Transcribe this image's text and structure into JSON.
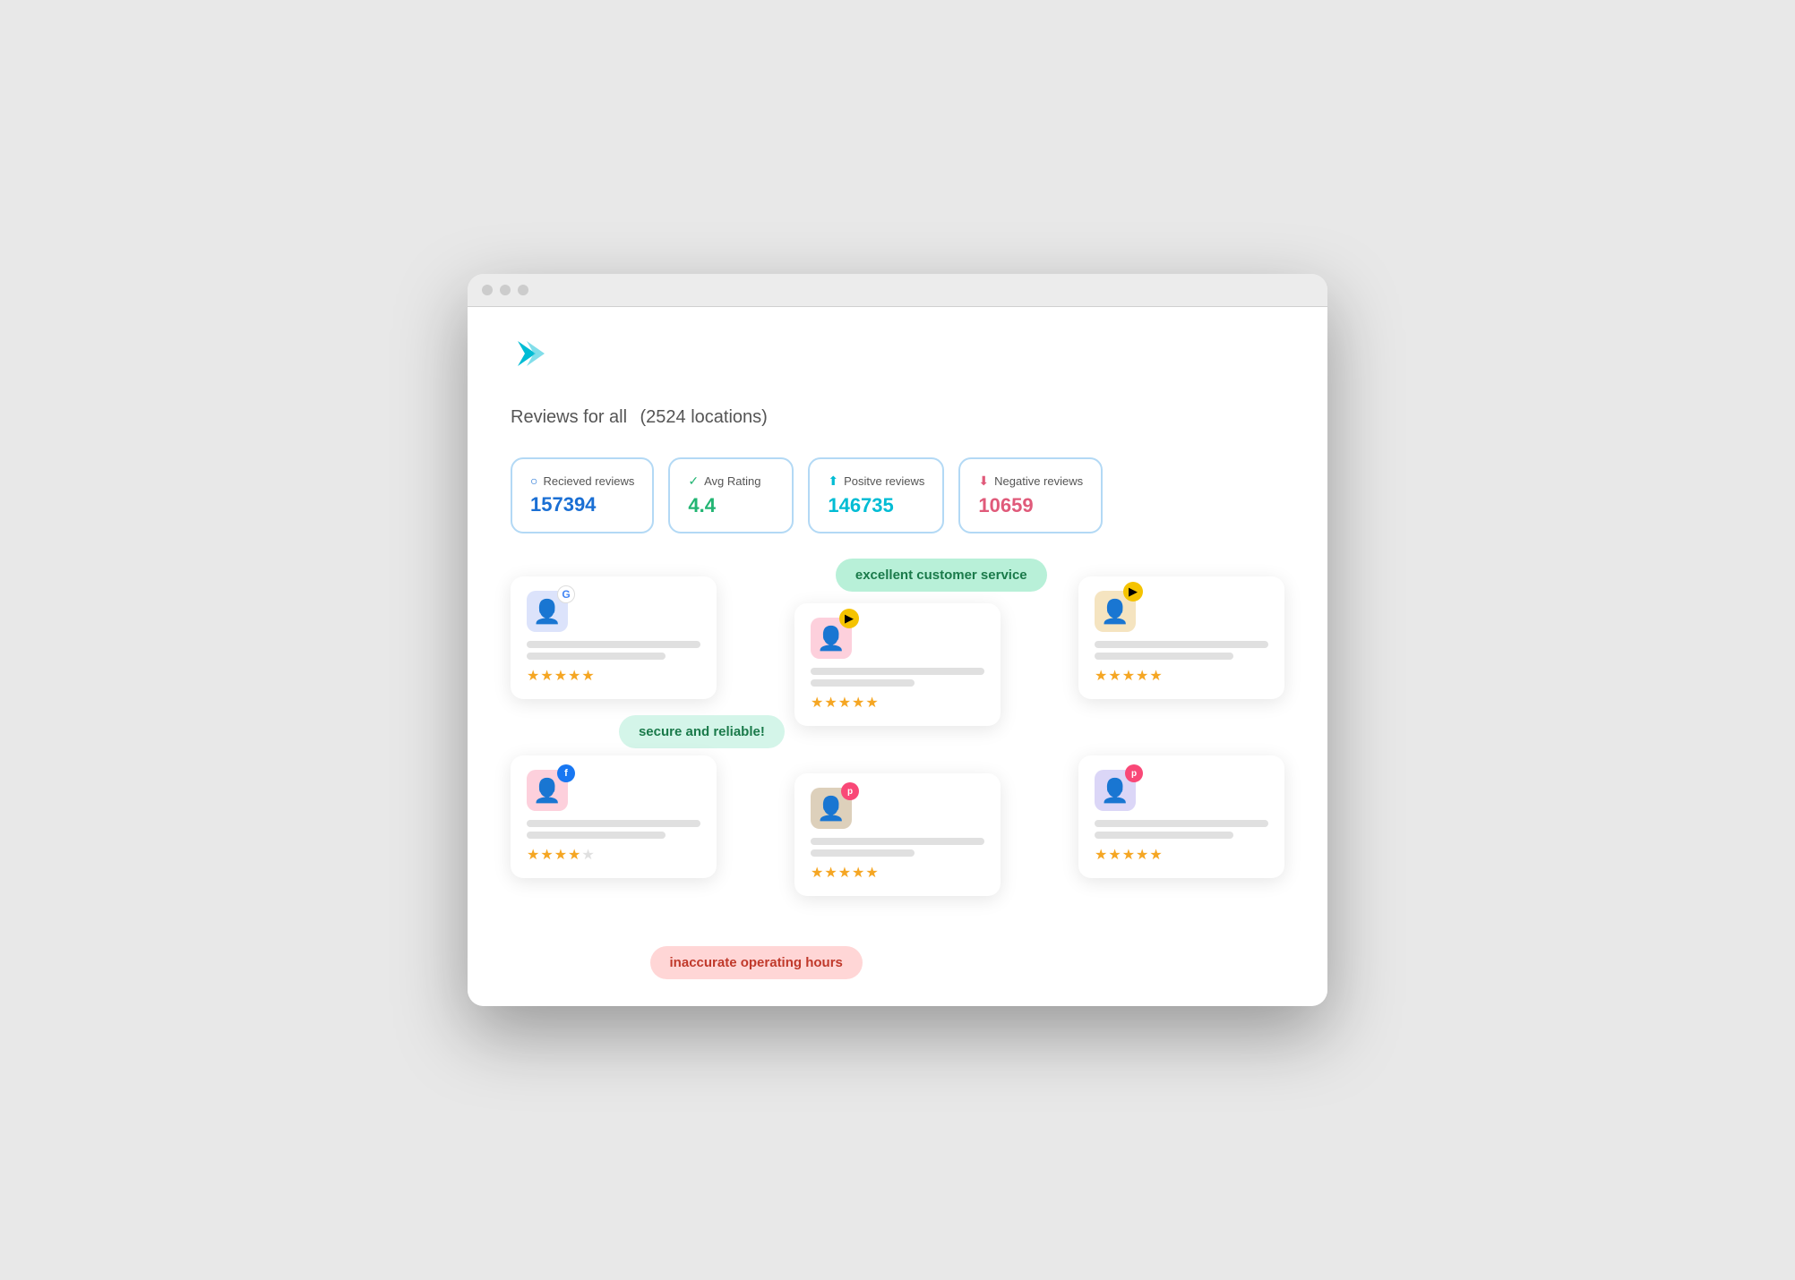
{
  "browser": {
    "dots": [
      "dot1",
      "dot2",
      "dot3"
    ]
  },
  "logo": {
    "alt": "Logo chevron"
  },
  "header": {
    "title": "Reviews for all",
    "subtitle": "(2524 locations)"
  },
  "stats": [
    {
      "id": "received",
      "label": "Recieved reviews",
      "value": "157394",
      "color": "blue",
      "icon": "○"
    },
    {
      "id": "avg-rating",
      "label": "Avg Rating",
      "value": "4.4",
      "color": "green",
      "icon": "✓"
    },
    {
      "id": "positive",
      "label": "Positve reviews",
      "value": "146735",
      "color": "teal",
      "icon": "⬆"
    },
    {
      "id": "negative",
      "label": "Negative reviews",
      "value": "10659",
      "color": "pink",
      "icon": "⬇"
    }
  ],
  "tags": [
    {
      "id": "excellent",
      "text": "excellent customer service",
      "type": "green"
    },
    {
      "id": "secure",
      "text": "secure and reliable!",
      "type": "teal"
    },
    {
      "id": "inaccurate",
      "text": "inaccurate operating hours",
      "type": "pink"
    }
  ],
  "reviews": [
    {
      "id": "r1",
      "avatar_color": "#c5cff5",
      "avatar_bg": "#dce3fb",
      "platform": "google",
      "platform_letter": "G",
      "platform_color": "#fff",
      "platform_text_color": "#4285f4",
      "stars": 5,
      "has_pin": false,
      "position": "top-left"
    },
    {
      "id": "r2",
      "avatar_color": "#f8a0b8",
      "avatar_bg": "#fdd0dc",
      "platform": "pin",
      "platform_letter": "▶",
      "platform_color": "#f5c300",
      "platform_text_color": "#000",
      "stars": 5,
      "has_pin": true,
      "position": "top-center"
    },
    {
      "id": "r3",
      "avatar_color": "#e8c98a",
      "avatar_bg": "#f5e4c0",
      "platform": "pin",
      "platform_letter": "▶",
      "platform_color": "#f5c300",
      "platform_text_color": "#000",
      "stars": 5,
      "has_pin": true,
      "position": "top-right"
    },
    {
      "id": "r4",
      "avatar_color": "#f8a0b8",
      "avatar_bg": "#fdd0dc",
      "platform": "facebook",
      "platform_letter": "f",
      "platform_color": "#1877f2",
      "platform_text_color": "#fff",
      "stars": 4,
      "has_pin": false,
      "position": "mid-left"
    },
    {
      "id": "r5",
      "avatar_color": "#c4a882",
      "avatar_bg": "#ddd0bb",
      "platform": "foursquare",
      "platform_letter": "p",
      "platform_color": "#f94877",
      "platform_text_color": "#fff",
      "stars": 5,
      "has_pin": false,
      "position": "mid-center"
    },
    {
      "id": "r6",
      "avatar_color": "#b8aee8",
      "avatar_bg": "#dbd6f7",
      "platform": "foursquare",
      "platform_letter": "p",
      "platform_color": "#f94877",
      "platform_text_color": "#fff",
      "stars": 5,
      "has_pin": false,
      "position": "mid-right"
    }
  ]
}
